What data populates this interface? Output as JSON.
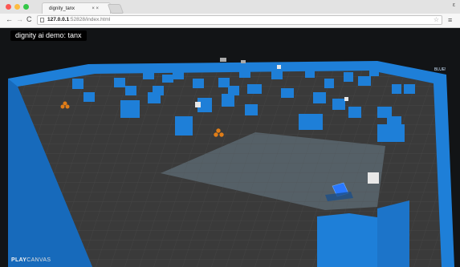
{
  "browser": {
    "tab_title": "dignity_tanx",
    "tab_close": "× ×",
    "url_host": "127.0.0.1",
    "url_path": ":52828/index.html",
    "nav_back": "←",
    "nav_forward": "→",
    "nav_reload": "C",
    "star": "☆",
    "menu": "≡",
    "window_button": "ε"
  },
  "app": {
    "title": "dignity ai demo: tanx",
    "brand_bold": "PLAY",
    "brand_light": "CANVAS",
    "team_label": "BLUE!"
  },
  "colors": {
    "wall_blue": "#1e7fd8",
    "wall_dark": "#0e4f8f",
    "floor": "#3a3a3a",
    "grid_line": "#4d4d4d",
    "spawn_zone": "#5a6670",
    "orange": "#e07d18"
  }
}
